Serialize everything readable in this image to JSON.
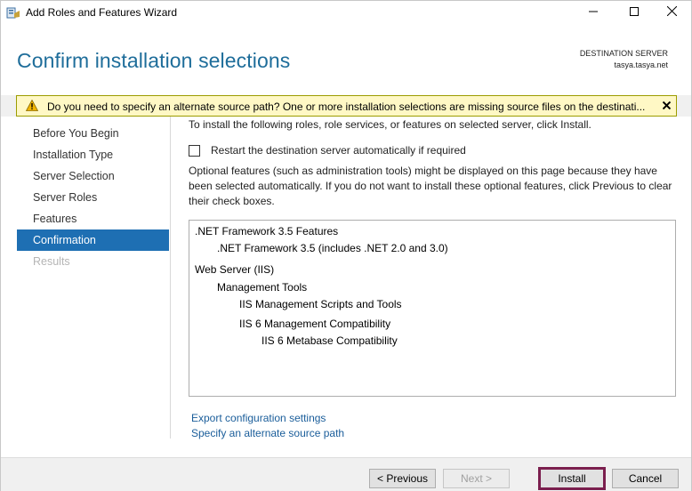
{
  "window": {
    "title": "Add Roles and Features Wizard"
  },
  "header": {
    "page_title": "Confirm installation selections",
    "destination_label": "DESTINATION SERVER",
    "destination_server": "tasya.tasya.net"
  },
  "warning": {
    "text": "Do you need to specify an alternate source path? One or more installation selections are missing source files on the destinati...",
    "accent_color": "#fff8c5"
  },
  "nav": {
    "items": [
      {
        "label": "Before You Begin",
        "state": "normal"
      },
      {
        "label": "Installation Type",
        "state": "normal"
      },
      {
        "label": "Server Selection",
        "state": "normal"
      },
      {
        "label": "Server Roles",
        "state": "normal"
      },
      {
        "label": "Features",
        "state": "normal"
      },
      {
        "label": "Confirmation",
        "state": "active"
      },
      {
        "label": "Results",
        "state": "disabled"
      }
    ],
    "active_color": "#1e6fb3"
  },
  "main": {
    "intro": "To install the following roles, role services, or features on selected server, click Install.",
    "restart_label": "Restart the destination server automatically if required",
    "restart_checked": false,
    "optional_text": "Optional features (such as administration tools) might be displayed on this page because they have been selected automatically. If you do not want to install these optional features, click Previous to clear their check boxes.",
    "selections": [
      {
        "label": ".NET Framework 3.5 Features",
        "level": 0
      },
      {
        "label": ".NET Framework 3.5 (includes .NET 2.0 and 3.0)",
        "level": 1
      },
      {
        "label": "Web Server (IIS)",
        "level": 0
      },
      {
        "label": "Management Tools",
        "level": 1
      },
      {
        "label": "IIS Management Scripts and Tools",
        "level": 2
      },
      {
        "label": "IIS 6 Management Compatibility",
        "level": 2
      },
      {
        "label": "IIS 6 Metabase Compatibility",
        "level": 3
      }
    ],
    "export_link": "Export configuration settings",
    "alt_source_link": "Specify an alternate source path"
  },
  "footer": {
    "previous_label": "< Previous",
    "next_label": "Next >",
    "install_label": "Install",
    "cancel_label": "Cancel"
  }
}
